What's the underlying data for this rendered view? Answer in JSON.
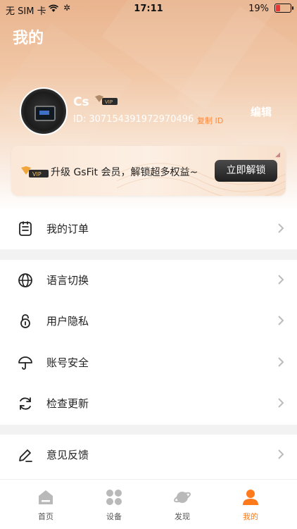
{
  "status": {
    "carrier": "无 SIM 卡",
    "time": "17:11",
    "battery": "19%"
  },
  "header": {
    "title": "我的"
  },
  "profile": {
    "name": "Cs",
    "id": "ID: 307154391972970496",
    "copy_id": "复制 ID",
    "edit": "编辑"
  },
  "vip_banner": {
    "text": "升级 GsFit 会员，解锁超多权益~",
    "button": "立即解锁"
  },
  "menu_top": [
    {
      "label": "我的订单",
      "icon": "order-icon"
    }
  ],
  "menu_mid": [
    {
      "label": "语言切换",
      "icon": "globe-icon"
    },
    {
      "label": "用户隐私",
      "icon": "lock-icon"
    },
    {
      "label": "账号安全",
      "icon": "umbrella-icon"
    },
    {
      "label": "检查更新",
      "icon": "refresh-icon"
    }
  ],
  "menu_bottom": [
    {
      "label": "意见反馈",
      "icon": "pencil-icon"
    }
  ],
  "tabs": [
    {
      "label": "首页",
      "icon": "home-icon"
    },
    {
      "label": "设备",
      "icon": "devices-icon"
    },
    {
      "label": "发现",
      "icon": "planet-icon"
    },
    {
      "label": "我的",
      "icon": "user-icon",
      "active": true
    }
  ],
  "colors": {
    "accent": "#ff7a1a",
    "header_top": "#e9b48e"
  }
}
